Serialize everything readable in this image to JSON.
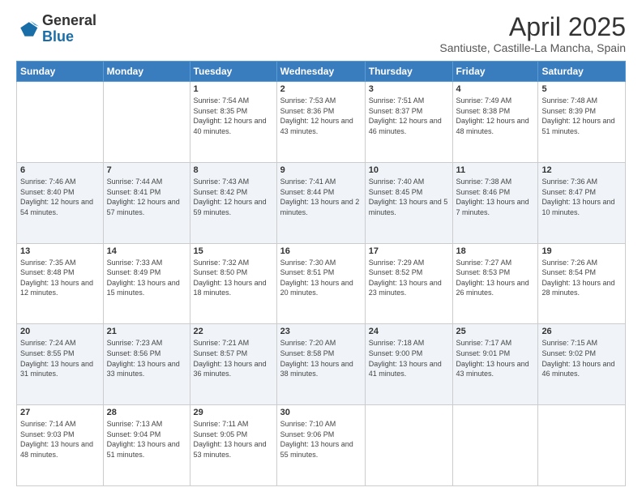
{
  "header": {
    "logo_general": "General",
    "logo_blue": "Blue",
    "title": "April 2025",
    "subtitle": "Santiuste, Castille-La Mancha, Spain"
  },
  "days_of_week": [
    "Sunday",
    "Monday",
    "Tuesday",
    "Wednesday",
    "Thursday",
    "Friday",
    "Saturday"
  ],
  "weeks": [
    [
      {
        "day": "",
        "info": ""
      },
      {
        "day": "",
        "info": ""
      },
      {
        "day": "1",
        "info": "Sunrise: 7:54 AM\nSunset: 8:35 PM\nDaylight: 12 hours and 40 minutes."
      },
      {
        "day": "2",
        "info": "Sunrise: 7:53 AM\nSunset: 8:36 PM\nDaylight: 12 hours and 43 minutes."
      },
      {
        "day": "3",
        "info": "Sunrise: 7:51 AM\nSunset: 8:37 PM\nDaylight: 12 hours and 46 minutes."
      },
      {
        "day": "4",
        "info": "Sunrise: 7:49 AM\nSunset: 8:38 PM\nDaylight: 12 hours and 48 minutes."
      },
      {
        "day": "5",
        "info": "Sunrise: 7:48 AM\nSunset: 8:39 PM\nDaylight: 12 hours and 51 minutes."
      }
    ],
    [
      {
        "day": "6",
        "info": "Sunrise: 7:46 AM\nSunset: 8:40 PM\nDaylight: 12 hours and 54 minutes."
      },
      {
        "day": "7",
        "info": "Sunrise: 7:44 AM\nSunset: 8:41 PM\nDaylight: 12 hours and 57 minutes."
      },
      {
        "day": "8",
        "info": "Sunrise: 7:43 AM\nSunset: 8:42 PM\nDaylight: 12 hours and 59 minutes."
      },
      {
        "day": "9",
        "info": "Sunrise: 7:41 AM\nSunset: 8:44 PM\nDaylight: 13 hours and 2 minutes."
      },
      {
        "day": "10",
        "info": "Sunrise: 7:40 AM\nSunset: 8:45 PM\nDaylight: 13 hours and 5 minutes."
      },
      {
        "day": "11",
        "info": "Sunrise: 7:38 AM\nSunset: 8:46 PM\nDaylight: 13 hours and 7 minutes."
      },
      {
        "day": "12",
        "info": "Sunrise: 7:36 AM\nSunset: 8:47 PM\nDaylight: 13 hours and 10 minutes."
      }
    ],
    [
      {
        "day": "13",
        "info": "Sunrise: 7:35 AM\nSunset: 8:48 PM\nDaylight: 13 hours and 12 minutes."
      },
      {
        "day": "14",
        "info": "Sunrise: 7:33 AM\nSunset: 8:49 PM\nDaylight: 13 hours and 15 minutes."
      },
      {
        "day": "15",
        "info": "Sunrise: 7:32 AM\nSunset: 8:50 PM\nDaylight: 13 hours and 18 minutes."
      },
      {
        "day": "16",
        "info": "Sunrise: 7:30 AM\nSunset: 8:51 PM\nDaylight: 13 hours and 20 minutes."
      },
      {
        "day": "17",
        "info": "Sunrise: 7:29 AM\nSunset: 8:52 PM\nDaylight: 13 hours and 23 minutes."
      },
      {
        "day": "18",
        "info": "Sunrise: 7:27 AM\nSunset: 8:53 PM\nDaylight: 13 hours and 26 minutes."
      },
      {
        "day": "19",
        "info": "Sunrise: 7:26 AM\nSunset: 8:54 PM\nDaylight: 13 hours and 28 minutes."
      }
    ],
    [
      {
        "day": "20",
        "info": "Sunrise: 7:24 AM\nSunset: 8:55 PM\nDaylight: 13 hours and 31 minutes."
      },
      {
        "day": "21",
        "info": "Sunrise: 7:23 AM\nSunset: 8:56 PM\nDaylight: 13 hours and 33 minutes."
      },
      {
        "day": "22",
        "info": "Sunrise: 7:21 AM\nSunset: 8:57 PM\nDaylight: 13 hours and 36 minutes."
      },
      {
        "day": "23",
        "info": "Sunrise: 7:20 AM\nSunset: 8:58 PM\nDaylight: 13 hours and 38 minutes."
      },
      {
        "day": "24",
        "info": "Sunrise: 7:18 AM\nSunset: 9:00 PM\nDaylight: 13 hours and 41 minutes."
      },
      {
        "day": "25",
        "info": "Sunrise: 7:17 AM\nSunset: 9:01 PM\nDaylight: 13 hours and 43 minutes."
      },
      {
        "day": "26",
        "info": "Sunrise: 7:15 AM\nSunset: 9:02 PM\nDaylight: 13 hours and 46 minutes."
      }
    ],
    [
      {
        "day": "27",
        "info": "Sunrise: 7:14 AM\nSunset: 9:03 PM\nDaylight: 13 hours and 48 minutes."
      },
      {
        "day": "28",
        "info": "Sunrise: 7:13 AM\nSunset: 9:04 PM\nDaylight: 13 hours and 51 minutes."
      },
      {
        "day": "29",
        "info": "Sunrise: 7:11 AM\nSunset: 9:05 PM\nDaylight: 13 hours and 53 minutes."
      },
      {
        "day": "30",
        "info": "Sunrise: 7:10 AM\nSunset: 9:06 PM\nDaylight: 13 hours and 55 minutes."
      },
      {
        "day": "",
        "info": ""
      },
      {
        "day": "",
        "info": ""
      },
      {
        "day": "",
        "info": ""
      }
    ]
  ]
}
